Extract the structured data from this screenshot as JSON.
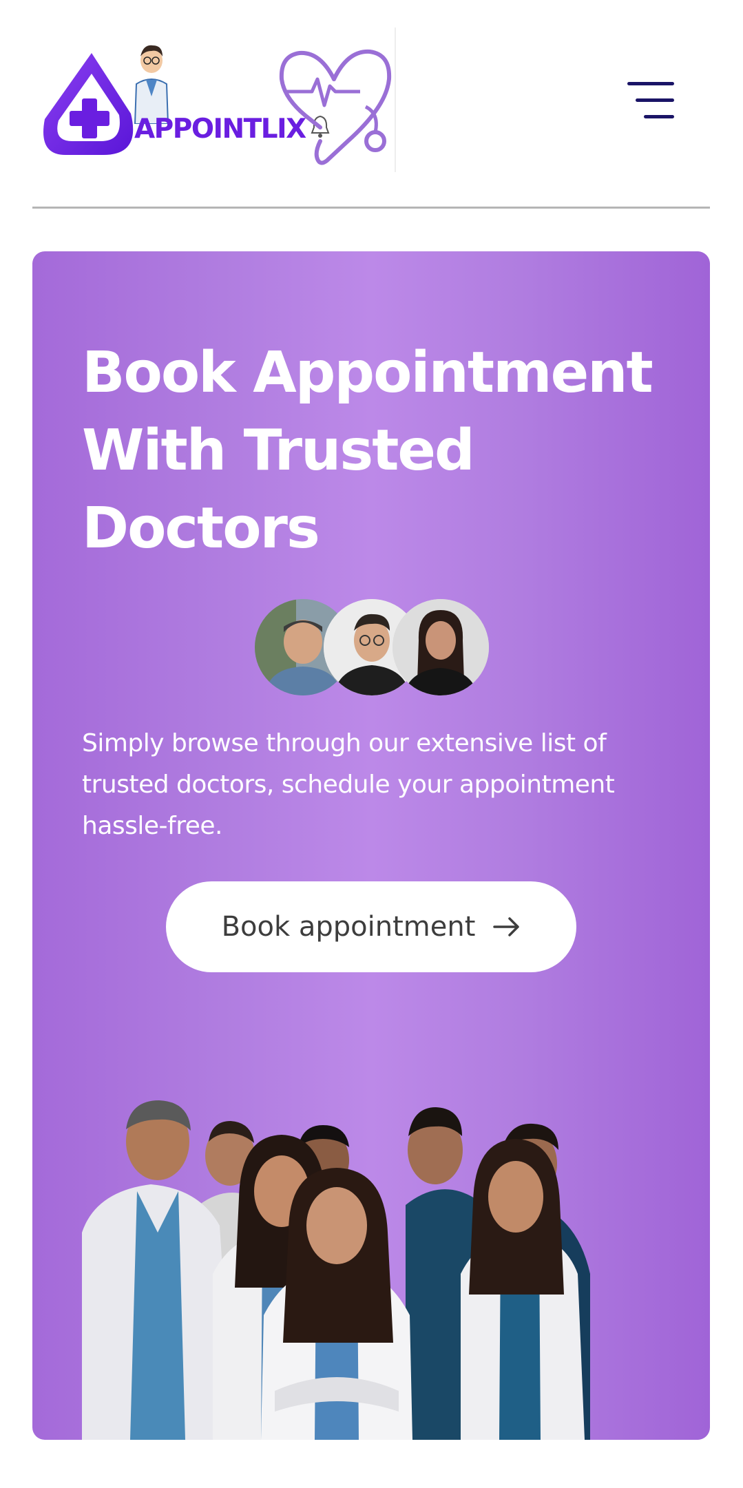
{
  "header": {
    "brand_name": "APPOINTLIX",
    "logo_icon": "medical-drop-cross-icon",
    "mascot_icon": "doctor-mascot-icon",
    "heartbeat_icon": "heart-stethoscope-icon",
    "bell_icon": "bell-icon",
    "menu_icon": "hamburger-menu-icon"
  },
  "hero": {
    "title_line1": "Book Appointment",
    "title_line2": "With Trusted",
    "title_line3": "Doctors",
    "description": "Simply browse through our extensive list of trusted doctors, schedule your appointment hassle-free.",
    "cta_label": "Book appointment",
    "cta_icon": "arrow-right-icon",
    "avatars": [
      "doctor-avatar-1",
      "doctor-avatar-2",
      "doctor-avatar-3"
    ],
    "team_image": "doctors-team-photo"
  },
  "colors": {
    "brand_purple": "#6a1ee0",
    "hero_purple": "#b07de0",
    "menu_navy": "#1a1466",
    "text_white": "#ffffff",
    "cta_text": "#3d3d3d"
  }
}
